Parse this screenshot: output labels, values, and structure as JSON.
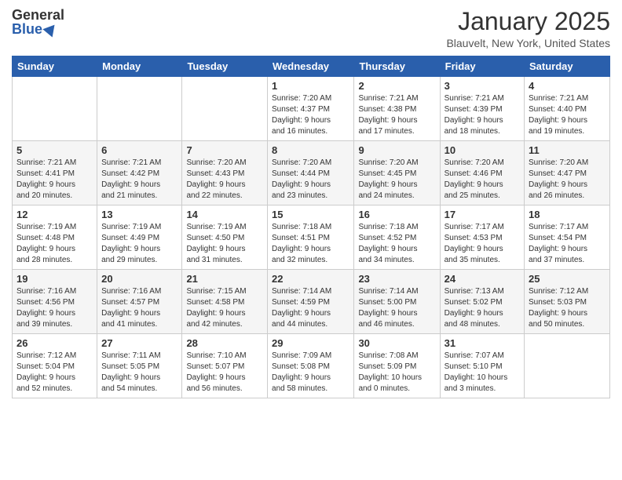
{
  "header": {
    "logo_general": "General",
    "logo_blue": "Blue",
    "title": "January 2025",
    "location": "Blauvelt, New York, United States"
  },
  "days_of_week": [
    "Sunday",
    "Monday",
    "Tuesday",
    "Wednesday",
    "Thursday",
    "Friday",
    "Saturday"
  ],
  "weeks": [
    [
      {
        "day": "",
        "info": ""
      },
      {
        "day": "",
        "info": ""
      },
      {
        "day": "",
        "info": ""
      },
      {
        "day": "1",
        "info": "Sunrise: 7:20 AM\nSunset: 4:37 PM\nDaylight: 9 hours\nand 16 minutes."
      },
      {
        "day": "2",
        "info": "Sunrise: 7:21 AM\nSunset: 4:38 PM\nDaylight: 9 hours\nand 17 minutes."
      },
      {
        "day": "3",
        "info": "Sunrise: 7:21 AM\nSunset: 4:39 PM\nDaylight: 9 hours\nand 18 minutes."
      },
      {
        "day": "4",
        "info": "Sunrise: 7:21 AM\nSunset: 4:40 PM\nDaylight: 9 hours\nand 19 minutes."
      }
    ],
    [
      {
        "day": "5",
        "info": "Sunrise: 7:21 AM\nSunset: 4:41 PM\nDaylight: 9 hours\nand 20 minutes."
      },
      {
        "day": "6",
        "info": "Sunrise: 7:21 AM\nSunset: 4:42 PM\nDaylight: 9 hours\nand 21 minutes."
      },
      {
        "day": "7",
        "info": "Sunrise: 7:20 AM\nSunset: 4:43 PM\nDaylight: 9 hours\nand 22 minutes."
      },
      {
        "day": "8",
        "info": "Sunrise: 7:20 AM\nSunset: 4:44 PM\nDaylight: 9 hours\nand 23 minutes."
      },
      {
        "day": "9",
        "info": "Sunrise: 7:20 AM\nSunset: 4:45 PM\nDaylight: 9 hours\nand 24 minutes."
      },
      {
        "day": "10",
        "info": "Sunrise: 7:20 AM\nSunset: 4:46 PM\nDaylight: 9 hours\nand 25 minutes."
      },
      {
        "day": "11",
        "info": "Sunrise: 7:20 AM\nSunset: 4:47 PM\nDaylight: 9 hours\nand 26 minutes."
      }
    ],
    [
      {
        "day": "12",
        "info": "Sunrise: 7:19 AM\nSunset: 4:48 PM\nDaylight: 9 hours\nand 28 minutes."
      },
      {
        "day": "13",
        "info": "Sunrise: 7:19 AM\nSunset: 4:49 PM\nDaylight: 9 hours\nand 29 minutes."
      },
      {
        "day": "14",
        "info": "Sunrise: 7:19 AM\nSunset: 4:50 PM\nDaylight: 9 hours\nand 31 minutes."
      },
      {
        "day": "15",
        "info": "Sunrise: 7:18 AM\nSunset: 4:51 PM\nDaylight: 9 hours\nand 32 minutes."
      },
      {
        "day": "16",
        "info": "Sunrise: 7:18 AM\nSunset: 4:52 PM\nDaylight: 9 hours\nand 34 minutes."
      },
      {
        "day": "17",
        "info": "Sunrise: 7:17 AM\nSunset: 4:53 PM\nDaylight: 9 hours\nand 35 minutes."
      },
      {
        "day": "18",
        "info": "Sunrise: 7:17 AM\nSunset: 4:54 PM\nDaylight: 9 hours\nand 37 minutes."
      }
    ],
    [
      {
        "day": "19",
        "info": "Sunrise: 7:16 AM\nSunset: 4:56 PM\nDaylight: 9 hours\nand 39 minutes."
      },
      {
        "day": "20",
        "info": "Sunrise: 7:16 AM\nSunset: 4:57 PM\nDaylight: 9 hours\nand 41 minutes."
      },
      {
        "day": "21",
        "info": "Sunrise: 7:15 AM\nSunset: 4:58 PM\nDaylight: 9 hours\nand 42 minutes."
      },
      {
        "day": "22",
        "info": "Sunrise: 7:14 AM\nSunset: 4:59 PM\nDaylight: 9 hours\nand 44 minutes."
      },
      {
        "day": "23",
        "info": "Sunrise: 7:14 AM\nSunset: 5:00 PM\nDaylight: 9 hours\nand 46 minutes."
      },
      {
        "day": "24",
        "info": "Sunrise: 7:13 AM\nSunset: 5:02 PM\nDaylight: 9 hours\nand 48 minutes."
      },
      {
        "day": "25",
        "info": "Sunrise: 7:12 AM\nSunset: 5:03 PM\nDaylight: 9 hours\nand 50 minutes."
      }
    ],
    [
      {
        "day": "26",
        "info": "Sunrise: 7:12 AM\nSunset: 5:04 PM\nDaylight: 9 hours\nand 52 minutes."
      },
      {
        "day": "27",
        "info": "Sunrise: 7:11 AM\nSunset: 5:05 PM\nDaylight: 9 hours\nand 54 minutes."
      },
      {
        "day": "28",
        "info": "Sunrise: 7:10 AM\nSunset: 5:07 PM\nDaylight: 9 hours\nand 56 minutes."
      },
      {
        "day": "29",
        "info": "Sunrise: 7:09 AM\nSunset: 5:08 PM\nDaylight: 9 hours\nand 58 minutes."
      },
      {
        "day": "30",
        "info": "Sunrise: 7:08 AM\nSunset: 5:09 PM\nDaylight: 10 hours\nand 0 minutes."
      },
      {
        "day": "31",
        "info": "Sunrise: 7:07 AM\nSunset: 5:10 PM\nDaylight: 10 hours\nand 3 minutes."
      },
      {
        "day": "",
        "info": ""
      }
    ]
  ]
}
